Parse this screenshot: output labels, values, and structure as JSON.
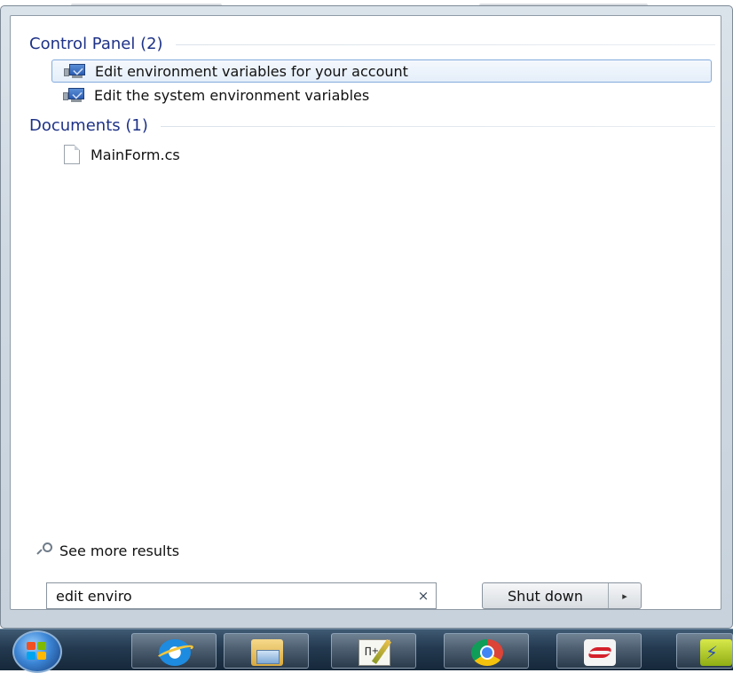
{
  "groups": [
    {
      "title": "Control Panel (2)",
      "items": [
        {
          "label": "Edit environment variables for your account",
          "icon": "control-panel-icon",
          "selected": true
        },
        {
          "label": "Edit the system environment variables",
          "icon": "control-panel-icon",
          "selected": false
        }
      ]
    },
    {
      "title": "Documents (1)",
      "items": [
        {
          "label": "MainForm.cs",
          "icon": "document-icon",
          "selected": false
        }
      ]
    }
  ],
  "see_more": {
    "label": "See more results",
    "icon": "search-icon"
  },
  "search": {
    "value": "edit enviro",
    "clear_glyph": "×"
  },
  "shutdown": {
    "label": "Shut down",
    "arrow_glyph": "▸"
  },
  "taskbar": {
    "start_icon": "windows-orb-icon",
    "apps": [
      {
        "icon": "internet-explorer-icon"
      },
      {
        "icon": "windows-explorer-icon"
      },
      {
        "icon": "notepad-plus-plus-icon"
      },
      {
        "icon": "chrome-icon"
      },
      {
        "icon": "red-app-icon"
      },
      {
        "icon": "lightning-app-icon"
      }
    ]
  },
  "colors": {
    "group_header": "#1e3287",
    "selection_border": "#84acdd",
    "taskbar": "#243a50"
  }
}
